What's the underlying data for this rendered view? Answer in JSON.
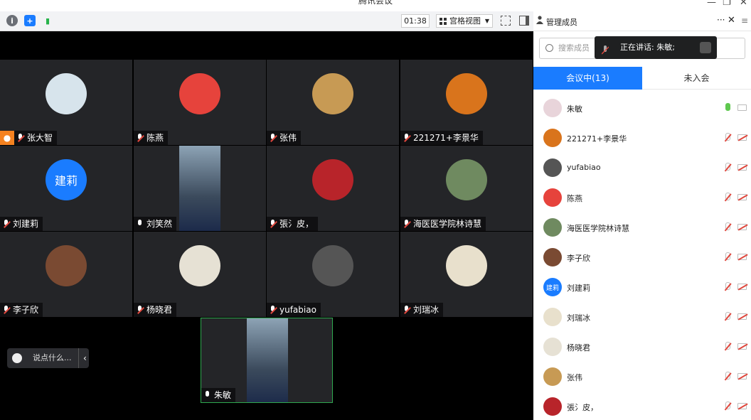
{
  "window": {
    "title": "腾讯会议",
    "minimize": "—",
    "restore": "❐",
    "close": "✕"
  },
  "toolbar": {
    "timer": "01:38",
    "view_label": "宫格视图",
    "info_icon": "i",
    "shield_icon": "+",
    "signal_icon": "▮"
  },
  "tiles": [
    {
      "name": "张大智",
      "muted": true,
      "host": true,
      "avatar_color": "#d7e4ec"
    },
    {
      "name": "陈燕",
      "muted": true,
      "avatar_color": "#e6433c"
    },
    {
      "name": "张伟",
      "muted": true,
      "avatar_color": "#c79a54"
    },
    {
      "name": "221271+李景华",
      "muted": true,
      "avatar_color": "#d9741c"
    },
    {
      "name": "刘建莉",
      "muted": true,
      "avatar_text": "建莉",
      "avatar_color": "#1a7cff"
    },
    {
      "name": "刘笑然",
      "muted": false,
      "video": true
    },
    {
      "name": "張氵皮，",
      "muted": true,
      "avatar_color": "#b8242a"
    },
    {
      "name": "海医医学院林诗慧",
      "muted": true,
      "avatar_color": "#6f8a60"
    },
    {
      "name": "李子欣",
      "muted": true,
      "avatar_color": "#7a4a32"
    },
    {
      "name": "杨晓君",
      "muted": true,
      "avatar_color": "#e6e1d4"
    },
    {
      "name": "yufabiao",
      "muted": true,
      "avatar_color": "#555555"
    },
    {
      "name": "刘瑞冰",
      "muted": true,
      "avatar_color": "#e8e0cc"
    },
    {
      "name": "朱敏",
      "muted": false,
      "video": true,
      "speaking": true
    }
  ],
  "chat": {
    "placeholder": "说点什么...",
    "arrow": "‹"
  },
  "panel": {
    "title": "管理成员",
    "more": "···",
    "close": "✕",
    "menu": "≡",
    "search_placeholder": "搜索成员",
    "speaking_label": "正在讲话: 朱敏;",
    "tab_in_meeting": "会议中(13)",
    "tab_not_joined": "未入会",
    "members": [
      {
        "name": "朱敏",
        "mic": "on",
        "avatar_color": "#e8d4da"
      },
      {
        "name": "221271+李景华",
        "mic": "muted",
        "avatar_color": "#d9741c"
      },
      {
        "name": "yufabiao",
        "mic": "muted",
        "avatar_color": "#555555"
      },
      {
        "name": "陈燕",
        "mic": "muted",
        "avatar_color": "#e6433c"
      },
      {
        "name": "海医医学院林诗慧",
        "mic": "muted",
        "avatar_color": "#6f8a60"
      },
      {
        "name": "李子欣",
        "mic": "muted",
        "avatar_color": "#7a4a32"
      },
      {
        "name": "刘建莉",
        "mic": "muted",
        "avatar_text": "建莉",
        "avatar_color": "#1a7cff"
      },
      {
        "name": "刘瑞冰",
        "mic": "muted",
        "avatar_color": "#e8e0cc"
      },
      {
        "name": "杨晓君",
        "mic": "muted",
        "avatar_color": "#e6e1d4"
      },
      {
        "name": "张伟",
        "mic": "muted",
        "avatar_color": "#c79a54"
      },
      {
        "name": "張氵皮，",
        "mic": "muted",
        "avatar_color": "#b8242a"
      }
    ]
  }
}
